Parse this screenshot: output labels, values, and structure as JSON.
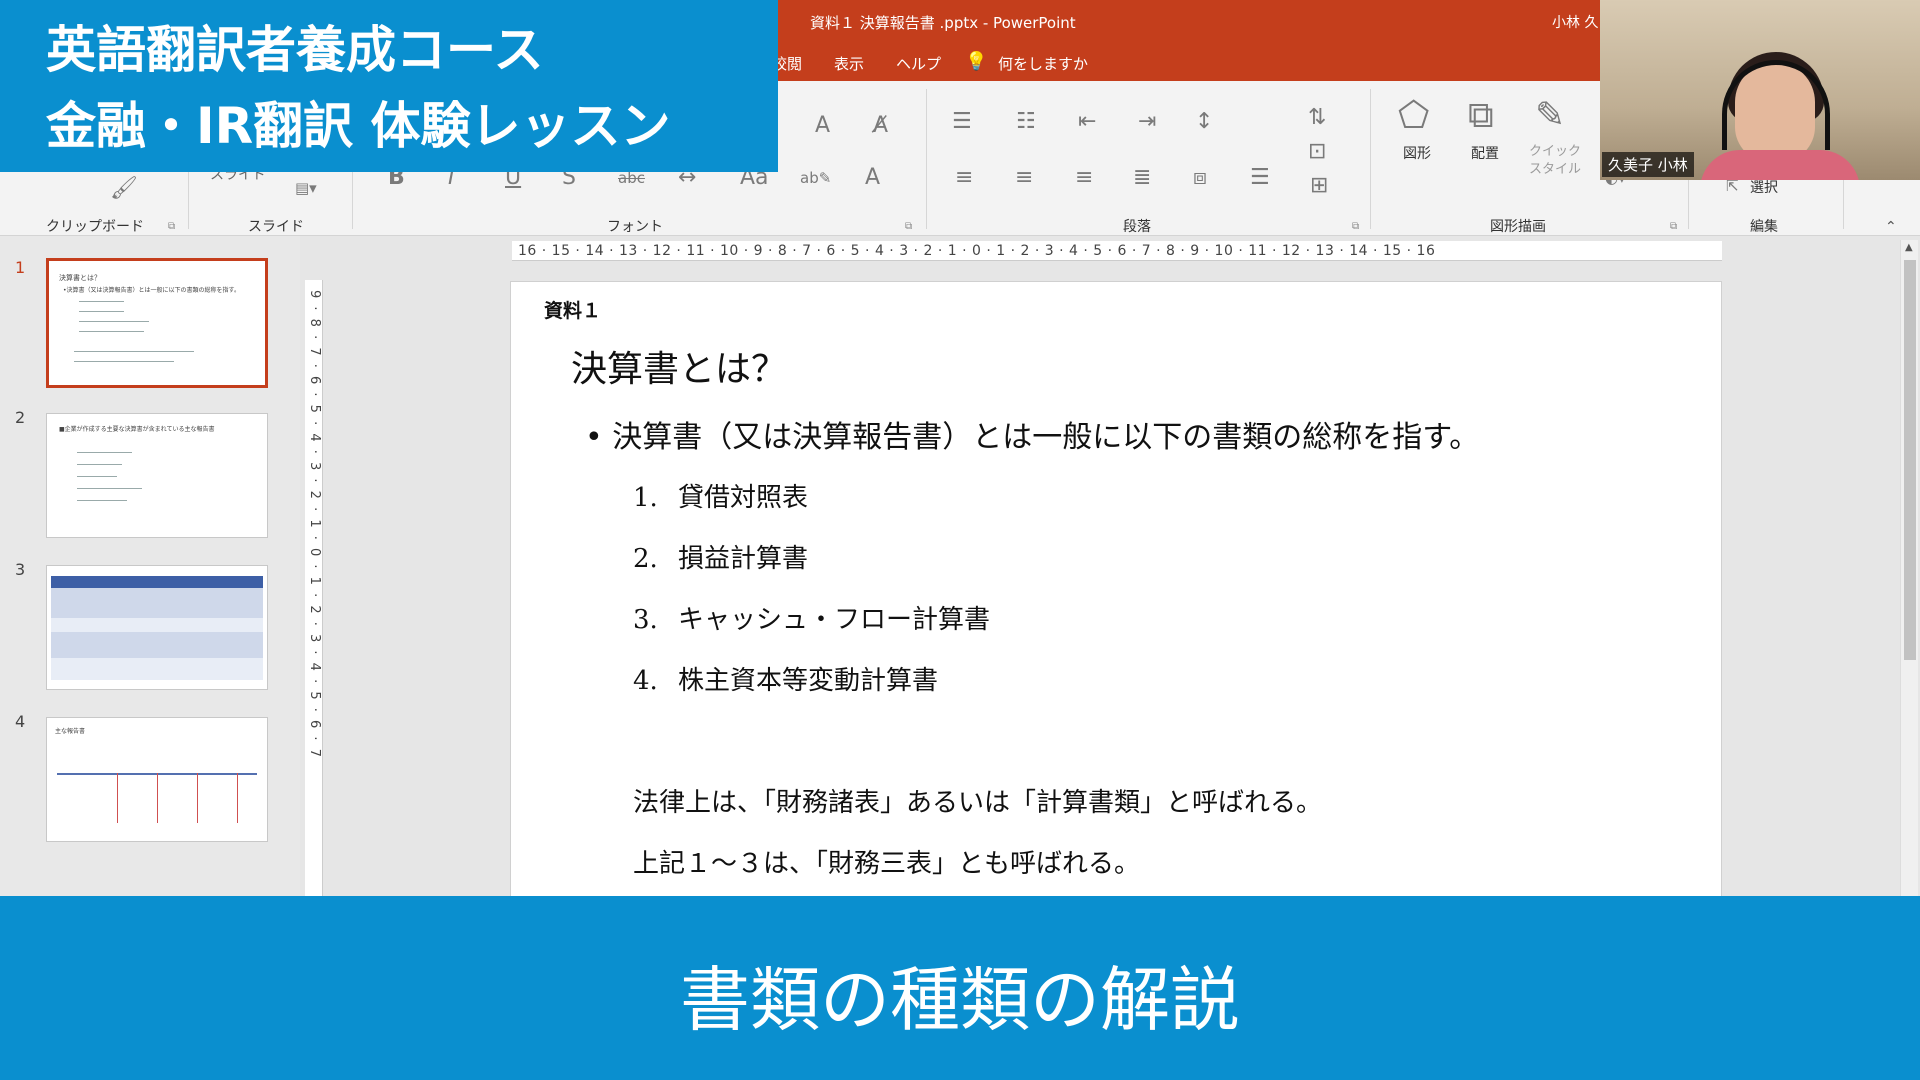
{
  "titlebar": {
    "doc_title": "資料１ 決算報告書 .pptx - PowerPoint",
    "user_name": "小林 久"
  },
  "tabs": [
    {
      "label": "校閲"
    },
    {
      "label": "表示"
    },
    {
      "label": "ヘルプ"
    },
    {
      "label": "何をしますか"
    }
  ],
  "ribbon": {
    "group_clipboard": "クリップボード",
    "group_slides": "スライド",
    "slide_button": "スライド",
    "group_font": "フォント",
    "group_paragraph": "段落",
    "group_drawing": "図形描画",
    "group_edit": "編集",
    "shapes_label": "図形",
    "arrange_label": "配置",
    "quick_style_label": "クイック スタイル",
    "select_label": "選択"
  },
  "ruler": {
    "horizontal": "16 · 15 · 14 · 13 · 12 · 11 · 10 · 9 · 8 · 7 · 6 · 5 · 4 · 3 · 2 · 1 · 0 · 1 · 2 · 3 · 4 · 5 · 6 · 7 · 8 · 9 · 10 · 11 · 12 · 13 · 14 · 15 · 16",
    "vertical": "9 · 8 · 7 · 6 · 5 · 4 · 3 · 2 · 1 · 0 · 1 · 2 · 3 · 4 · 5 · 6 · 7"
  },
  "thumbnails": [
    {
      "number": "1",
      "title": "決算書とは？",
      "line": "•決算書（又は決算報告書）とは一般に以下の書類の総称を指す。"
    },
    {
      "number": "2",
      "title": "■企業が作成する主要な決算書が含まれている主な報告書"
    },
    {
      "number": "3"
    },
    {
      "number": "4",
      "title": "主な報告書"
    }
  ],
  "slide": {
    "label": "資料１",
    "title": "決算書とは？",
    "bullet": "• 決算書（又は決算報告書）とは一般に以下の書類の総称を指す。",
    "items": [
      {
        "num": "1.",
        "text": "貸借対照表"
      },
      {
        "num": "2.",
        "text": "損益計算書"
      },
      {
        "num": "3.",
        "text": "キャッシュ・フロー計算書"
      },
      {
        "num": "4.",
        "text": "株主資本等変動計算書"
      }
    ],
    "note1": "法律上は、「財務諸表」あるいは「計算書類」と呼ばれる。",
    "note2": "上記１～３は、「財務三表」とも呼ばれる。"
  },
  "overlay": {
    "banner_line1": "英語翻訳者養成コース",
    "banner_line2": "金融・IR翻訳 体験レッスン",
    "caption": "書類の種類の解説"
  },
  "webcam": {
    "name": "久美子 小林"
  },
  "colors": {
    "accent": "#c43e1c",
    "overlay_blue": "#0a8fcf"
  }
}
